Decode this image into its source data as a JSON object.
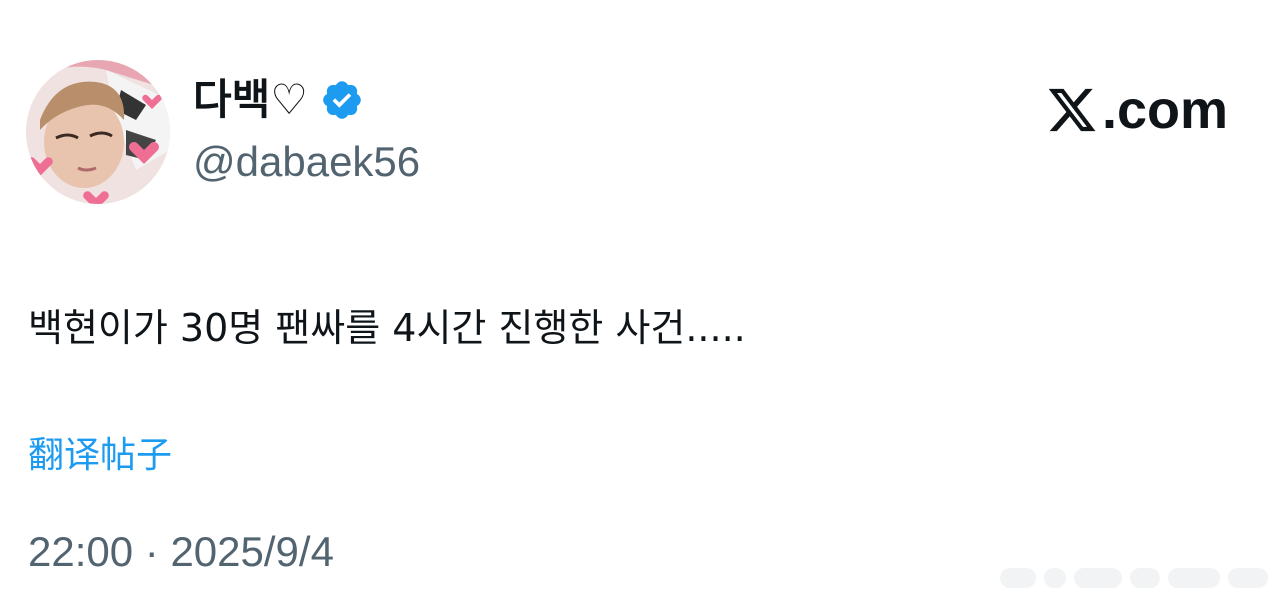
{
  "author": {
    "display_name": "다백♡",
    "handle": "@dabaek56",
    "verified": true
  },
  "brand": {
    "logo_icon": "x-logo-icon",
    "logo_text": ".com"
  },
  "tweet": {
    "text": "백현이가 30명 팬싸를 4시간 진행한 사건.....",
    "translate_label": "翻译帖子",
    "time": "22:00",
    "separator": "·",
    "date": "2025/9/4"
  },
  "colors": {
    "link": "#1d9bf0",
    "secondary_text": "#536471",
    "primary_text": "#0f1419",
    "verified_badge": "#1d9bf0"
  },
  "icons": {
    "avatar": "avatar-image",
    "verified": "verified-badge-icon"
  }
}
